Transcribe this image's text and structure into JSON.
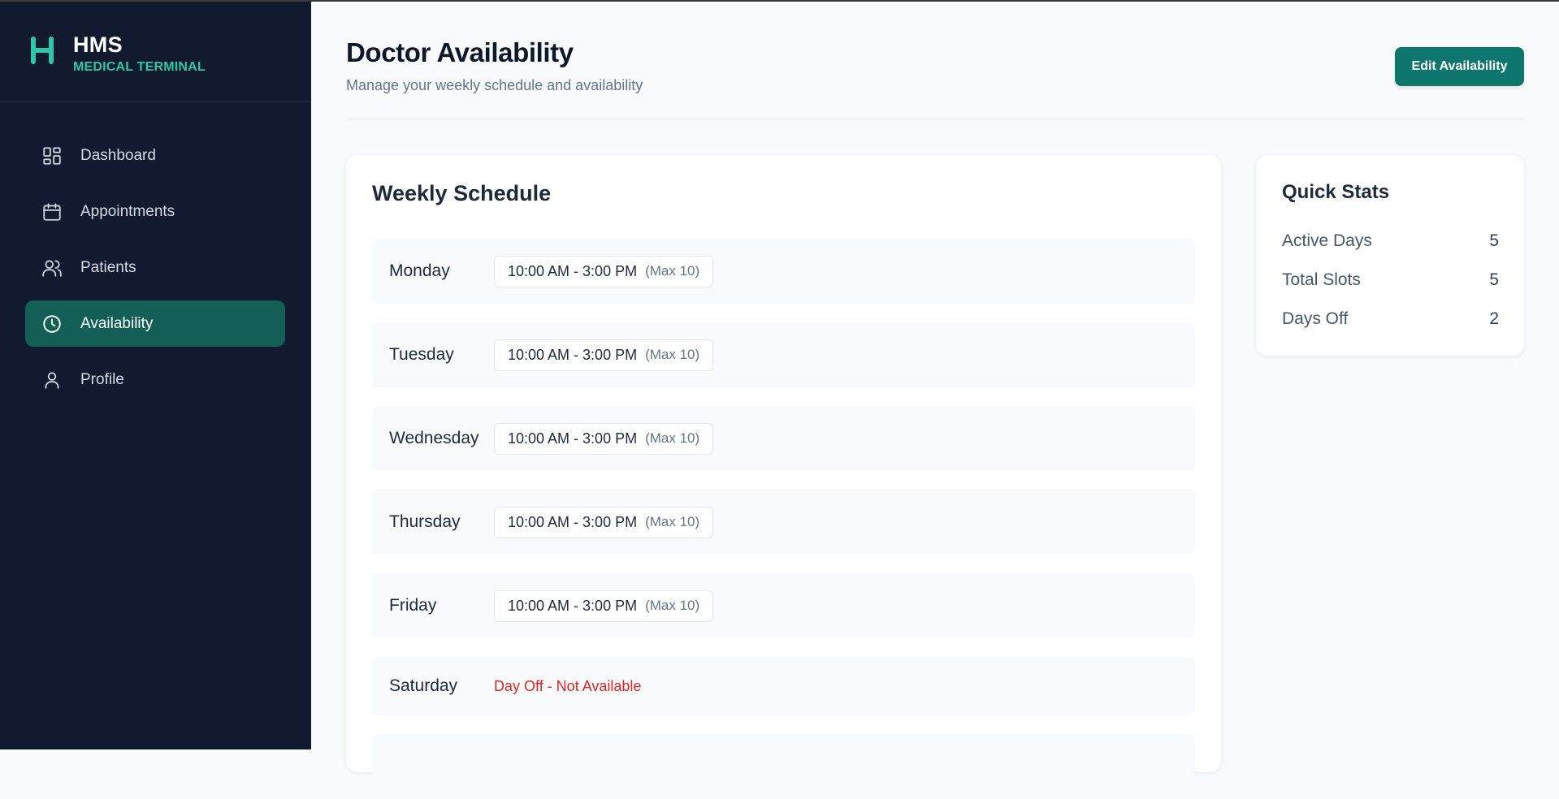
{
  "brand": {
    "name": "HMS",
    "subtitle": "MEDICAL TERMINAL",
    "logo_icon": "hms-logo-icon",
    "accent": "#2fc6a9"
  },
  "sidebar": {
    "items": [
      {
        "label": "Dashboard",
        "icon": "grid-icon",
        "active": false
      },
      {
        "label": "Appointments",
        "icon": "calendar-icon",
        "active": false
      },
      {
        "label": "Patients",
        "icon": "users-icon",
        "active": false
      },
      {
        "label": "Availability",
        "icon": "clock-icon",
        "active": true
      },
      {
        "label": "Profile",
        "icon": "user-icon",
        "active": false
      }
    ]
  },
  "header": {
    "title": "Doctor Availability",
    "subtitle": "Manage your weekly schedule and availability",
    "edit_button": "Edit Availability"
  },
  "schedule": {
    "title": "Weekly Schedule",
    "days": [
      {
        "day": "Monday",
        "slot": "10:00 AM - 3:00 PM",
        "max": "(Max 10)"
      },
      {
        "day": "Tuesday",
        "slot": "10:00 AM - 3:00 PM",
        "max": "(Max 10)"
      },
      {
        "day": "Wednesday",
        "slot": "10:00 AM - 3:00 PM",
        "max": "(Max 10)"
      },
      {
        "day": "Thursday",
        "slot": "10:00 AM - 3:00 PM",
        "max": "(Max 10)"
      },
      {
        "day": "Friday",
        "slot": "10:00 AM - 3:00 PM",
        "max": "(Max 10)"
      },
      {
        "day": "Saturday",
        "off_text": "Day Off - Not Available"
      }
    ]
  },
  "stats": {
    "title": "Quick Stats",
    "rows": [
      {
        "label": "Active Days",
        "value": "5"
      },
      {
        "label": "Total Slots",
        "value": "5"
      },
      {
        "label": "Days Off",
        "value": "2"
      }
    ]
  },
  "colors": {
    "sidebar_bg": "#111a2e",
    "primary": "#0f766e",
    "danger": "#dc2626"
  }
}
